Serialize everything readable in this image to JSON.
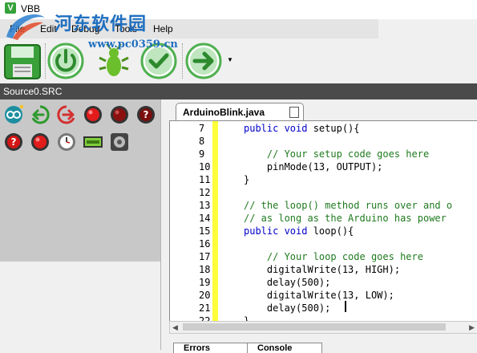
{
  "window": {
    "title": "VBB",
    "logo_char": "V"
  },
  "watermark": {
    "text": "河东软件园",
    "url": "www.pc0359.cn"
  },
  "menu": [
    "File",
    "Edit",
    "Debug",
    "Tools",
    "Help"
  ],
  "toolbar": {
    "buttons": [
      {
        "name": "save-icon"
      },
      {
        "name": "power-icon"
      },
      {
        "name": "debug-bug-icon"
      },
      {
        "name": "check-icon"
      },
      {
        "name": "run-arrow-icon"
      }
    ],
    "dropdown_glyph": "▼"
  },
  "source_bar": {
    "label": "Source0.SRC"
  },
  "palette": {
    "icons": [
      "arduino-icon",
      "input-arrow-icon",
      "output-arrow-icon",
      "red-button-icon",
      "dark-red-button-icon",
      "help-dark-icon",
      "help-red-icon",
      "red-stop-icon",
      "clock-icon",
      "lcd-display-icon",
      "buzzer-icon"
    ]
  },
  "editor": {
    "tab_label": "ArduinoBlink.java",
    "lines": [
      {
        "no": "7",
        "text": "public void setup(){",
        "kind": "code"
      },
      {
        "no": "8",
        "text": "",
        "kind": "code"
      },
      {
        "no": "9",
        "text": "    // Your setup code goes here",
        "kind": "comment"
      },
      {
        "no": "10",
        "text": "    pinMode(13, OUTPUT);",
        "kind": "code"
      },
      {
        "no": "11",
        "text": "}",
        "kind": "code"
      },
      {
        "no": "12",
        "text": "",
        "kind": "code"
      },
      {
        "no": "13",
        "text": "// the loop() method runs over and o",
        "kind": "comment"
      },
      {
        "no": "14",
        "text": "// as long as the Arduino has power",
        "kind": "comment"
      },
      {
        "no": "15",
        "text": "public void loop(){",
        "kind": "code"
      },
      {
        "no": "16",
        "text": "",
        "kind": "code"
      },
      {
        "no": "17",
        "text": "    // Your loop code goes here",
        "kind": "comment"
      },
      {
        "no": "18",
        "text": "    digitalWrite(13, HIGH);",
        "kind": "code"
      },
      {
        "no": "19",
        "text": "    delay(500);",
        "kind": "code"
      },
      {
        "no": "20",
        "text": "    digitalWrite(13, LOW);",
        "kind": "code"
      },
      {
        "no": "21",
        "text": "    delay(500);",
        "kind": "code"
      },
      {
        "no": "22",
        "text": "}",
        "kind": "code"
      }
    ]
  },
  "bottom_tabs": [
    "Errors",
    "Console"
  ],
  "colors": {
    "accent": "#35a13a",
    "gutter": "#ffff3a",
    "comment": "#1f7a1f",
    "keyword": "#0000cc",
    "source_bar": "#4a4a4a"
  }
}
